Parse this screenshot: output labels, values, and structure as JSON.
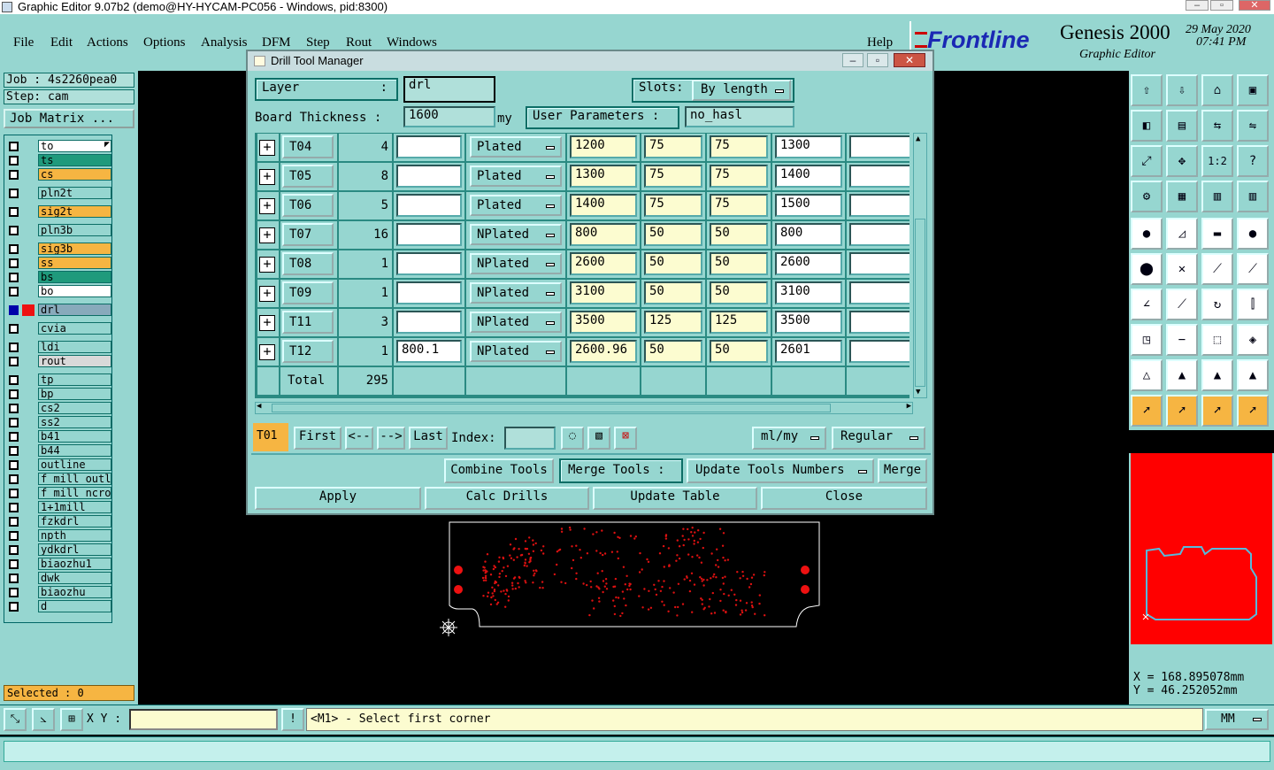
{
  "app": {
    "title": "Graphic Editor 9.07b2 (demo@HY-HYCAM-PC056 - Windows, pid:8300)",
    "menu": [
      "File",
      "Edit",
      "Actions",
      "Options",
      "Analysis",
      "DFM",
      "Step",
      "Rout",
      "Windows"
    ],
    "help": "Help",
    "logo": {
      "brand": "Frontline",
      "product": "Genesis 2000",
      "subtitle": "Graphic Editor",
      "date": "29 May 2020",
      "time": "07:41 PM"
    }
  },
  "job": {
    "job": "Job : 4s2260pea0",
    "step": "Step: cam",
    "matrix_btn": "Job Matrix ..."
  },
  "layers": [
    {
      "name": "to",
      "color": "#ffffff",
      "mark": "⬏"
    },
    {
      "name": "ts",
      "color": "#1f9a7c"
    },
    {
      "name": "cs",
      "color": "#f6b542"
    },
    {
      "name": "pln2t",
      "color": "#96d6d0"
    },
    {
      "name": "sig2t",
      "color": "#f6b542"
    },
    {
      "name": "pln3b",
      "color": "#96d6d0"
    },
    {
      "name": "sig3b",
      "color": "#f6b542"
    },
    {
      "name": "ss",
      "color": "#f6b542"
    },
    {
      "name": "bs",
      "color": "#1f9a7c"
    },
    {
      "name": "bo",
      "color": "#ffffff"
    },
    {
      "name": "drl",
      "color": "#96d6d0",
      "active": true
    },
    {
      "name": "cvia",
      "color": "#96d6d0"
    },
    {
      "name": "ldi",
      "color": "#96d6d0"
    },
    {
      "name": "rout",
      "color": "#d9d9d9"
    },
    {
      "name": "tp",
      "color": "#96d6d0"
    },
    {
      "name": "bp",
      "color": "#96d6d0"
    },
    {
      "name": "cs2",
      "color": "#96d6d0"
    },
    {
      "name": "ss2",
      "color": "#96d6d0"
    },
    {
      "name": "b41",
      "color": "#96d6d0"
    },
    {
      "name": "b44",
      "color": "#96d6d0"
    },
    {
      "name": "outline",
      "color": "#96d6d0"
    },
    {
      "name": "f_mill_outl:",
      "color": "#96d6d0"
    },
    {
      "name": "f_mill_ncrou",
      "color": "#96d6d0"
    },
    {
      "name": "1+1mill",
      "color": "#96d6d0"
    },
    {
      "name": "fzkdrl",
      "color": "#96d6d0"
    },
    {
      "name": "npth",
      "color": "#96d6d0"
    },
    {
      "name": "ydkdrl",
      "color": "#96d6d0"
    },
    {
      "name": "biaozhu1",
      "color": "#96d6d0"
    },
    {
      "name": "dwk",
      "color": "#96d6d0"
    },
    {
      "name": "biaozhu",
      "color": "#96d6d0"
    },
    {
      "name": "d",
      "color": "#96d6d0"
    }
  ],
  "selected": "Selected : 0",
  "dialog": {
    "title": "Drill Tool Manager",
    "layer_label": "Layer",
    "layer_colon": ":",
    "layer_value": "drl",
    "slots_label": "Slots:",
    "slots_value": "By length",
    "thickness_label": "Board Thickness :",
    "thickness_value": "1600",
    "thickness_unit": "my",
    "user_params_label": "User Parameters :",
    "user_params_value": "no_hasl",
    "rows": [
      {
        "tool": "T04",
        "count": "4",
        "extra": "",
        "type": "Plated",
        "v1": "1200",
        "v2": "75",
        "v3": "75",
        "v4": "1300",
        "extra2": ""
      },
      {
        "tool": "T05",
        "count": "8",
        "extra": "",
        "type": "Plated",
        "v1": "1300",
        "v2": "75",
        "v3": "75",
        "v4": "1400",
        "extra2": ""
      },
      {
        "tool": "T06",
        "count": "5",
        "extra": "",
        "type": "Plated",
        "v1": "1400",
        "v2": "75",
        "v3": "75",
        "v4": "1500",
        "extra2": ""
      },
      {
        "tool": "T07",
        "count": "16",
        "extra": "",
        "type": "NPlated",
        "v1": "800",
        "v2": "50",
        "v3": "50",
        "v4": "800",
        "extra2": ""
      },
      {
        "tool": "T08",
        "count": "1",
        "extra": "",
        "type": "NPlated",
        "v1": "2600",
        "v2": "50",
        "v3": "50",
        "v4": "2600",
        "extra2": ""
      },
      {
        "tool": "T09",
        "count": "1",
        "extra": "",
        "type": "NPlated",
        "v1": "3100",
        "v2": "50",
        "v3": "50",
        "v4": "3100",
        "extra2": ""
      },
      {
        "tool": "T11",
        "count": "3",
        "extra": "",
        "type": "NPlated",
        "v1": "3500",
        "v2": "125",
        "v3": "125",
        "v4": "3500",
        "extra2": ""
      },
      {
        "tool": "T12",
        "count": "1",
        "extra": "800.1",
        "type": "NPlated",
        "v1": "2600.96",
        "v2": "50",
        "v3": "50",
        "v4": "2601",
        "extra2": ""
      }
    ],
    "total_label": "Total",
    "total_value": "295",
    "nav": {
      "current": "T01",
      "first": "First",
      "prev": "<--",
      "next": "-->",
      "last": "Last",
      "index_label": "Index:",
      "index_value": "",
      "units": "ml/my",
      "mode": "Regular"
    },
    "buttons": {
      "combine": "Combine Tools",
      "merge_tools": "Merge Tools :",
      "update_numbers": "Update Tools Numbers",
      "merge": "Merge",
      "apply": "Apply",
      "calc": "Calc Drills",
      "update_table": "Update Table",
      "close": "Close"
    }
  },
  "coords": {
    "x": "X = 168.895078mm",
    "y": "Y = 46.252052mm"
  },
  "statusbar": {
    "xy_label": "X Y :",
    "xy_value": "",
    "prompt": "<M1> - Select first corner",
    "units": "MM"
  }
}
